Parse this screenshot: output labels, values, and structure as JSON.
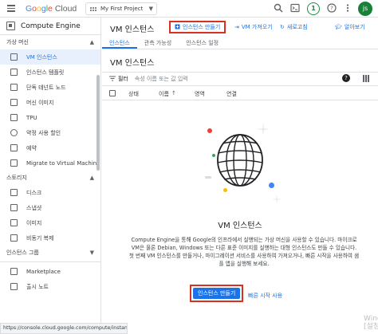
{
  "topbar": {
    "logo_google": "Google",
    "logo_cloud": "Cloud",
    "project": "My First Project",
    "notification_count": "1",
    "avatar": "js"
  },
  "sidebar": {
    "title": "Compute Engine",
    "sections": [
      {
        "label": "가상 머신",
        "items": [
          "VM 인스턴스",
          "인스턴스 템플릿",
          "단독 테넌트 노드",
          "머신 이미지",
          "TPU",
          "약정 사용 할인",
          "예약",
          "Migrate to Virtual Machin..."
        ]
      },
      {
        "label": "스토리지",
        "items": [
          "디스크",
          "스냅샷",
          "이미지",
          "비동기 복제"
        ]
      },
      {
        "label": "인스턴스 그룹",
        "items": []
      }
    ],
    "bottom_items": [
      "Marketplace",
      "출시 노트"
    ],
    "collapse": "‹"
  },
  "status_url": "https://console.cloud.google.com/compute/instancesA...",
  "main": {
    "title": "VM 인스턴스",
    "actions": {
      "create": "인스턴스 만들기",
      "import": "VM 가져오기",
      "refresh": "새로고침",
      "learn": "알아보기"
    },
    "tabs": [
      "인스턴스",
      "관측 가능성",
      "인스턴스 일정"
    ],
    "subtitle": "VM 인스턴스",
    "filter_label": "필터",
    "filter_placeholder": "속성 이름 또는 값 입력",
    "columns": [
      "상태",
      "이름",
      "영역",
      "연결"
    ],
    "empty_title": "VM 인스턴스",
    "empty_desc": "Compute Engine을 통해 Google의 인프라에서 실행되는 가상 머신을 사용할 수 있습니다. 마이크로 VM은 물론 Debian, Windows 또는 다른 표준 이미지를 실행하는 대형 인스턴스도 만들 수 있습니다. 첫 번째 VM 인스턴스를 만들거나, 마이그레이션 서비스를 사용하여 가져오거나, 빠른 시작을 사용하여 샘플 앱을 실행해 보세요.",
    "create_button": "인스턴스 만들기",
    "quickstart": "빠른 시작 사용"
  },
  "windows_mark": [
    "Winc",
    "[설정"
  ],
  "colors": {
    "accent": "#1a73e8",
    "highlight": "#d93025",
    "active_bg": "#e8f0fe"
  }
}
